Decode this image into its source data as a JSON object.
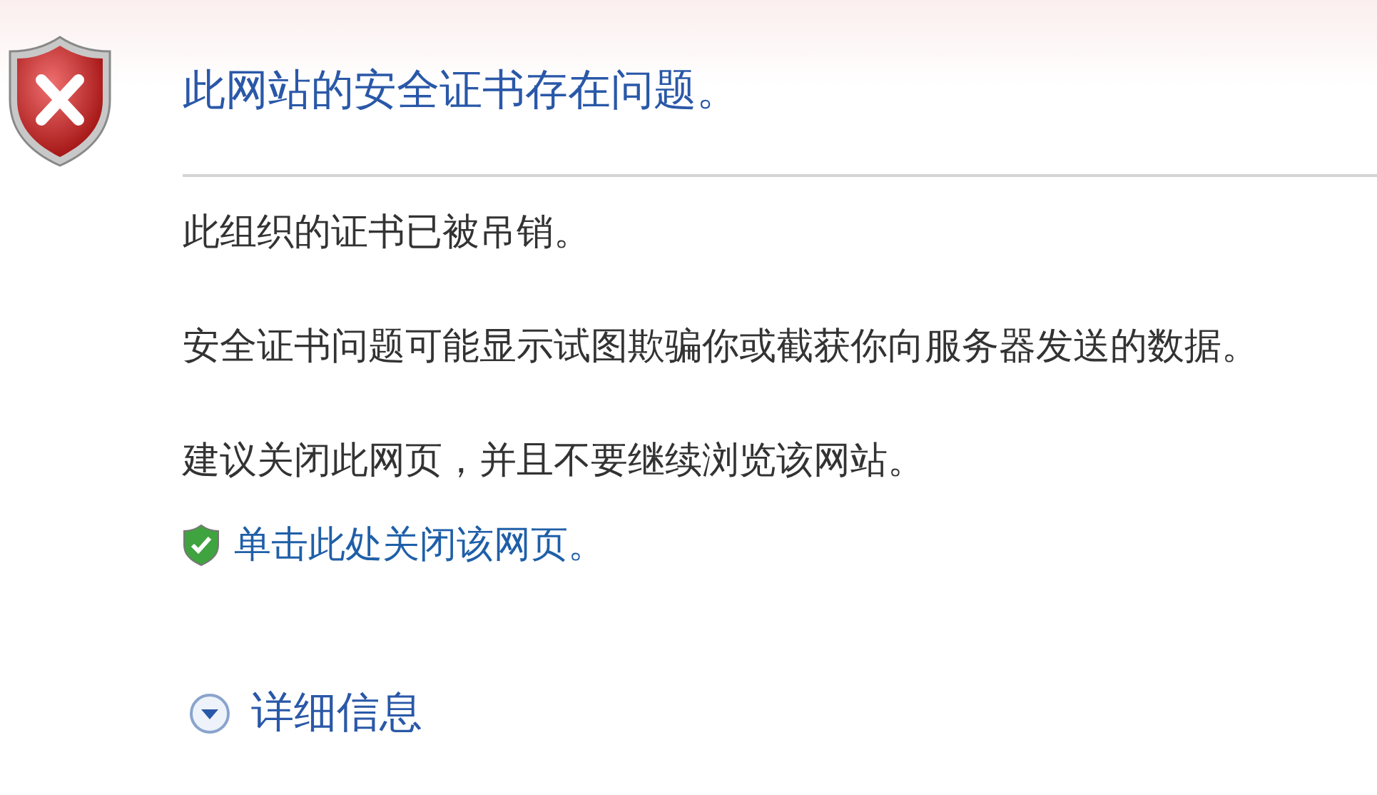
{
  "title": "此网站的安全证书存在问题。",
  "messages": [
    "此组织的证书已被吊销。",
    "安全证书问题可能显示试图欺骗你或截获你向服务器发送的数据。",
    "建议关闭此网页，并且不要继续浏览该网站。"
  ],
  "close_link": "单击此处关闭该网页。",
  "details": {
    "label": "详细信息",
    "expanded": false
  }
}
